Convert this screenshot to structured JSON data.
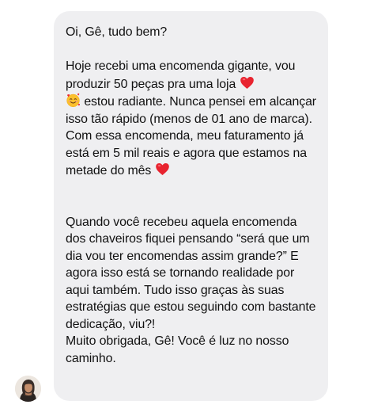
{
  "message": {
    "greeting": "Oi, Gê, tudo bem?",
    "p1_a": "Hoje recebi uma encomenda gigante, vou produzir 50 peças pra uma loja ",
    "p1_b": " estou radiante. Nunca pensei em alcançar isso tão rápido (menos de 01 ano de marca). Com essa encomenda, meu faturamento já está em 5 mil reais e agora que estamos na metade do mês ",
    "p2": "Quando você recebeu aquela encomenda dos chaveiros fiquei pensando “será que um dia vou ter encomendas assim grande?” E agora isso está se tornando realidade por aqui também. Tudo isso graças às suas estratégias que estou seguindo com bastante dedicação, viu?!",
    "p3": "Muito obrigada, Gê! Você é luz no nosso caminho."
  },
  "icons": {
    "heart": "red-heart-icon",
    "smiling_hearts": "smiling-face-with-hearts-icon"
  },
  "colors": {
    "bubble": "#efeff1",
    "text": "#111111",
    "heart": "#e8232f"
  }
}
